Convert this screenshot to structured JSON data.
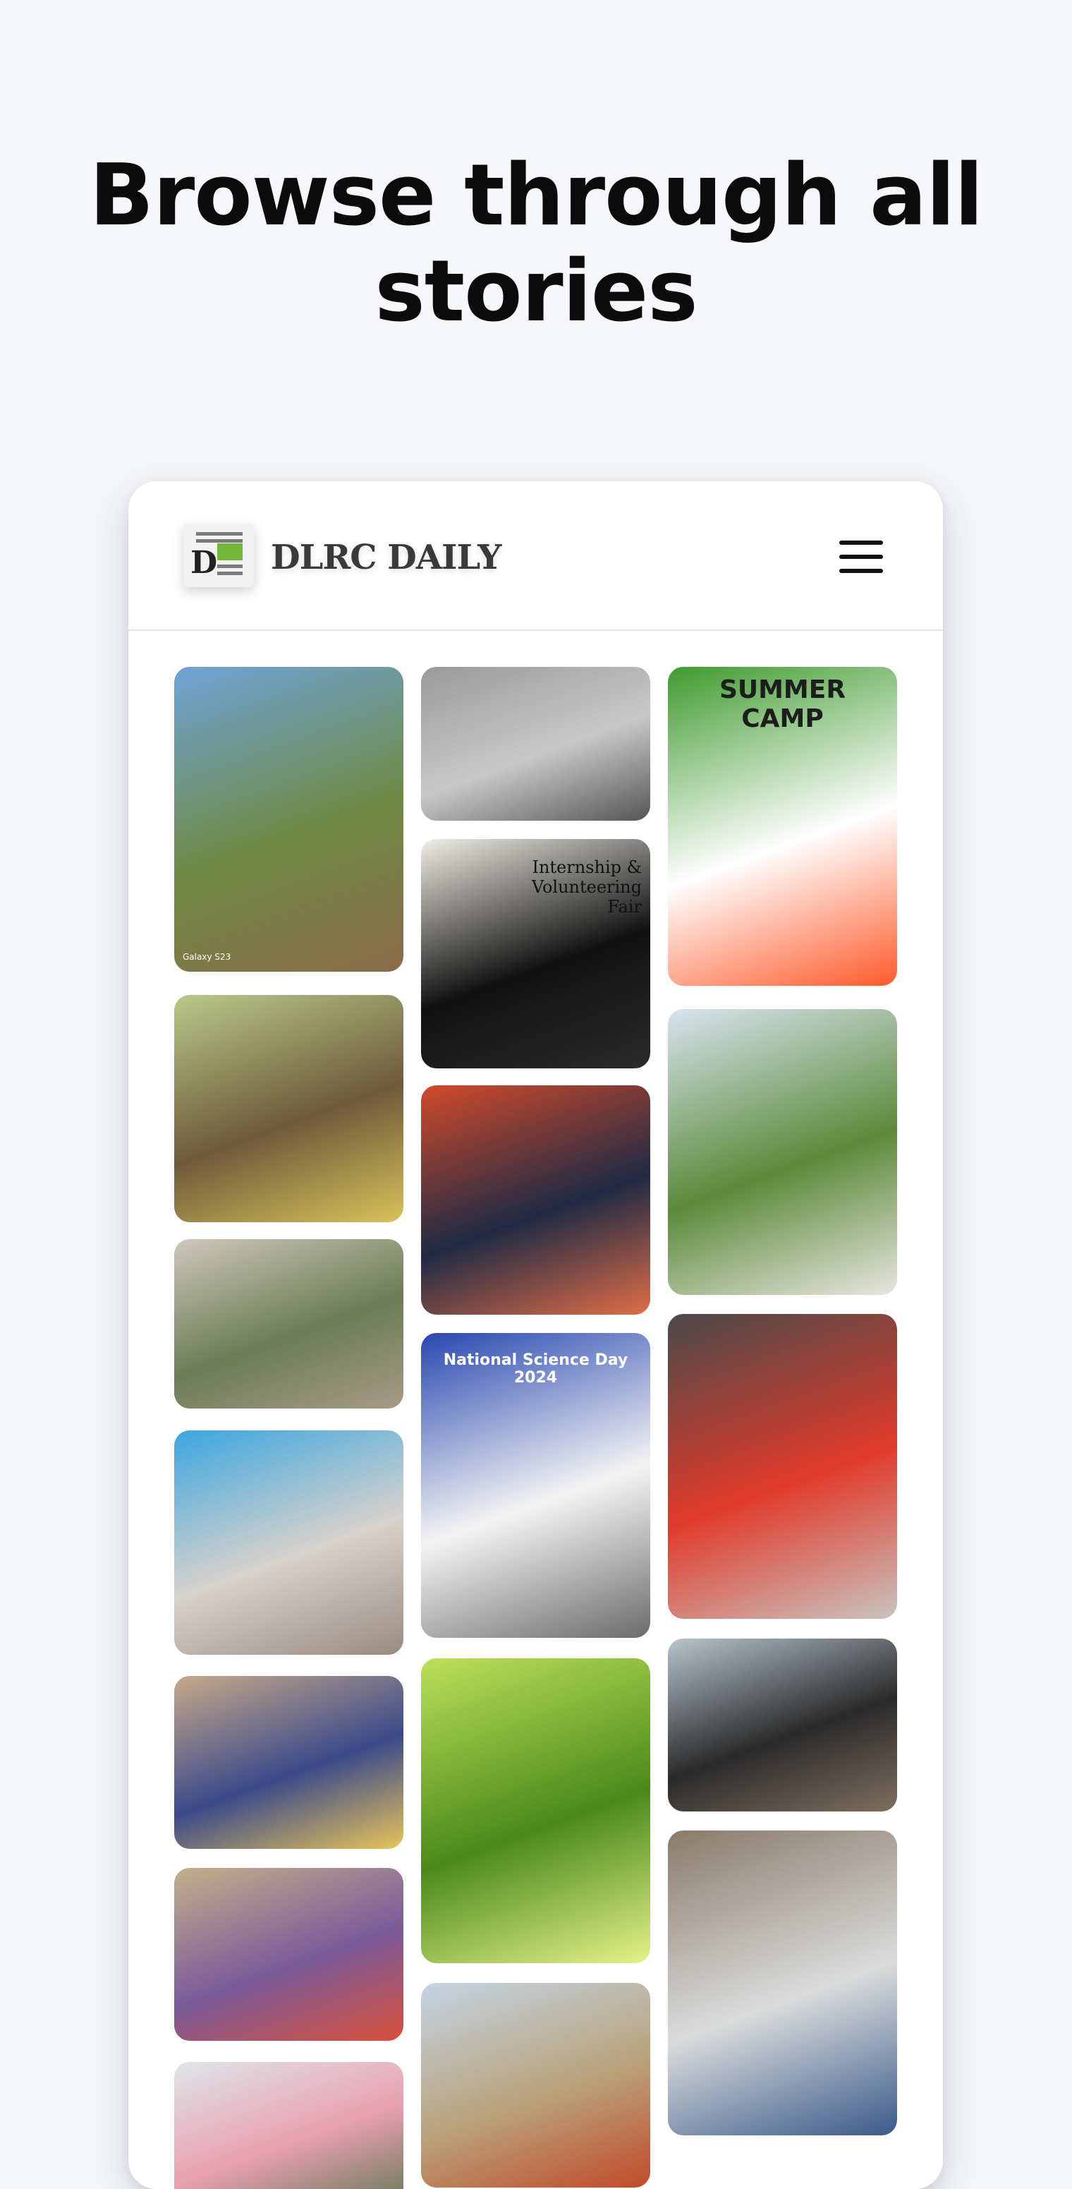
{
  "page": {
    "headline": "Browse through all stories"
  },
  "header": {
    "brand": "DLRC DAILY",
    "logo_letter": "D",
    "menu_icon": "hamburger-menu-icon"
  },
  "tiles": [
    {
      "name": "story-tile-tree-planting",
      "caption": "Galaxy S23",
      "colors": [
        "#6fa3d8",
        "#6f8a44",
        "#8a6a4a"
      ]
    },
    {
      "name": "story-tile-chess-map",
      "caption": "",
      "colors": [
        "#9a9a9a",
        "#c8c8c8",
        "#555555"
      ]
    },
    {
      "name": "story-tile-summer-camp",
      "caption": "SUMMER CAMP",
      "colors": [
        "#3f9a2e",
        "#ffffff",
        "#ff5a2a"
      ]
    },
    {
      "name": "story-tile-girl-portrait",
      "caption": "",
      "colors": [
        "#b9c98a",
        "#6e5a3a",
        "#d9c25a"
      ]
    },
    {
      "name": "story-tile-internship-fair",
      "caption": "Internship & Volunteering Fair",
      "colors": [
        "#f1eee6",
        "#111111",
        "#2b2b2b"
      ]
    },
    {
      "name": "story-tile-boy-garden",
      "caption": "",
      "colors": [
        "#d8e4ef",
        "#5c8a3a",
        "#e8e6e0"
      ]
    },
    {
      "name": "story-tile-student-suit",
      "caption": "",
      "colors": [
        "#d24a2a",
        "#1f2a44",
        "#e06d47"
      ]
    },
    {
      "name": "story-tile-playground-ball",
      "caption": "",
      "colors": [
        "#cfc7bc",
        "#6b7d55",
        "#a89a88"
      ]
    },
    {
      "name": "story-tile-science-day",
      "caption": "National Science Day 2024",
      "colors": [
        "#2747b0",
        "#f4f4f4",
        "#6b6b6b"
      ]
    },
    {
      "name": "story-tile-tomato-art",
      "caption": "",
      "colors": [
        "#4a4a4a",
        "#e13a2a",
        "#c9c3bf"
      ]
    },
    {
      "name": "story-tile-craft-collage",
      "caption": "",
      "colors": [
        "#3aa6e0",
        "#d8d2cc",
        "#9a8b80"
      ]
    },
    {
      "name": "story-tile-group-selfie",
      "caption": "",
      "colors": [
        "#b8c4cf",
        "#2a2a2a",
        "#7f6e5f"
      ]
    },
    {
      "name": "story-tile-clay-work",
      "caption": "",
      "colors": [
        "#c7a98a",
        "#3b4a8a",
        "#e8c45a"
      ]
    },
    {
      "name": "story-tile-green-leaf",
      "caption": "",
      "colors": [
        "#bde05a",
        "#4a8a1a",
        "#e6f28a"
      ]
    },
    {
      "name": "story-tile-costume-group",
      "caption": "",
      "colors": [
        "#c4b08a",
        "#7a5a9a",
        "#d9503a"
      ]
    },
    {
      "name": "story-tile-upside-down",
      "caption": "",
      "colors": [
        "#8a7a6a",
        "#dadcdc",
        "#3a5a8a"
      ]
    },
    {
      "name": "story-tile-sports-field",
      "caption": "",
      "colors": [
        "#c4d4e4",
        "#b9a27a",
        "#c24a2a"
      ]
    },
    {
      "name": "story-tile-collage-bottom",
      "caption": "",
      "colors": [
        "#dfe6ea",
        "#e9a0b0",
        "#6a7a5a"
      ]
    }
  ]
}
